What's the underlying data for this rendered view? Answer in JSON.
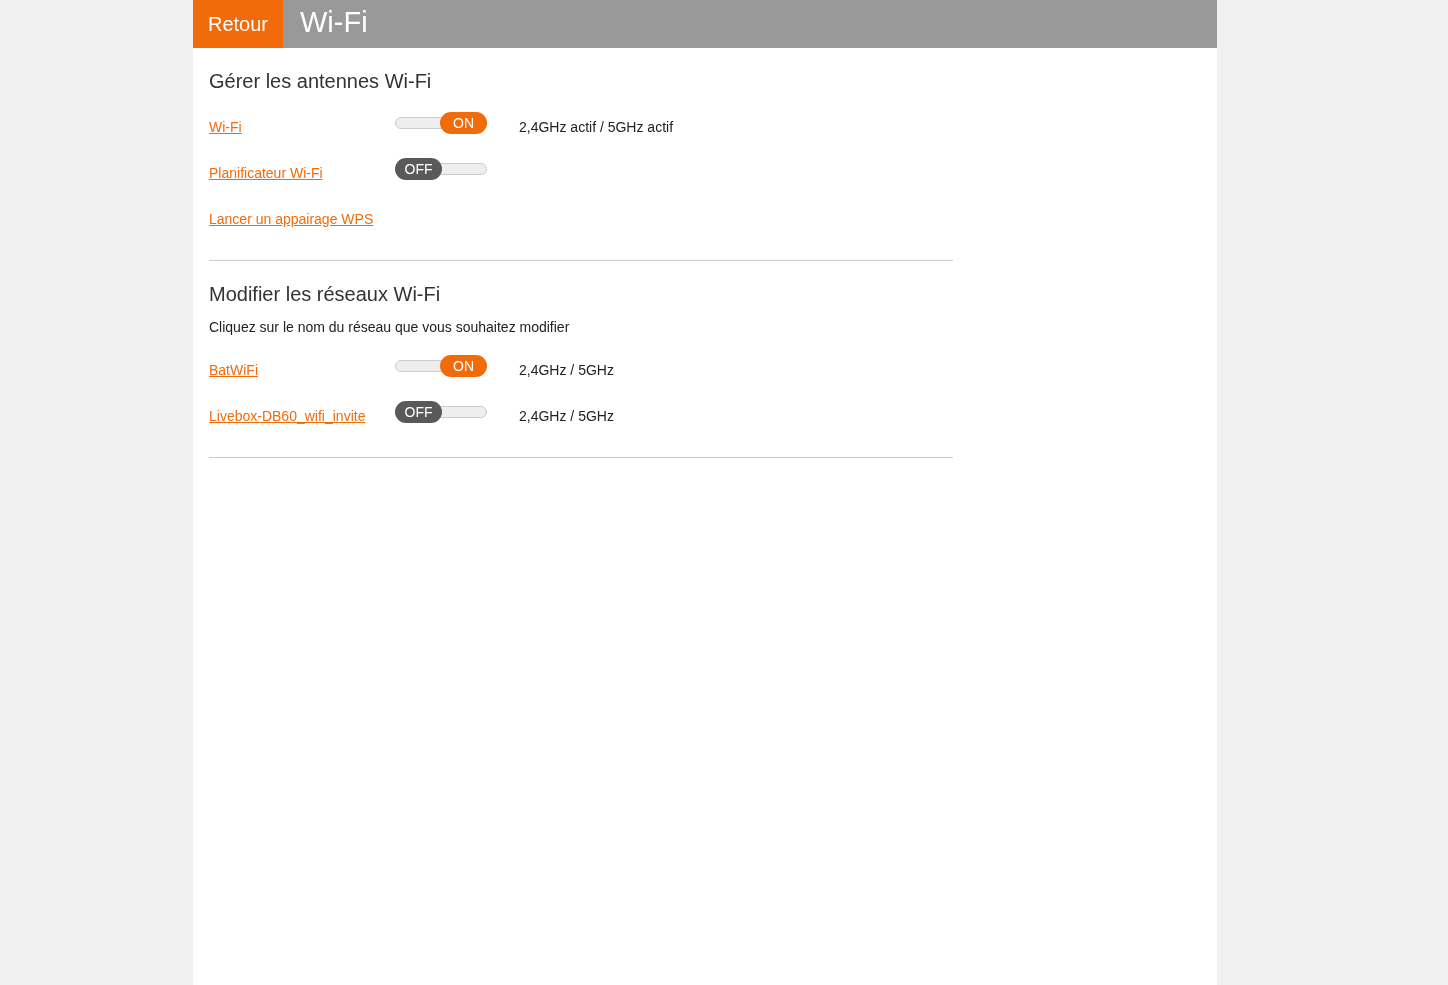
{
  "header": {
    "back_button": "Retour",
    "title": "Wi-Fi"
  },
  "sections": [
    {
      "title": "Gérer les antennes Wi-Fi",
      "rows": [
        {
          "label": "Wi-Fi",
          "toggle": {
            "on": true,
            "label": "ON"
          },
          "status": "2,4GHz actif / 5GHz actif"
        },
        {
          "label": "Planificateur Wi-Fi",
          "toggle": {
            "on": false,
            "label": "OFF"
          }
        },
        {
          "label": "Lancer un appairage WPS"
        }
      ]
    },
    {
      "title": "Modifier les réseaux Wi-Fi",
      "hint": "Cliquez sur le nom du réseau que vous souhaitez modifier",
      "rows": [
        {
          "label": "BatWiFi",
          "toggle": {
            "on": true,
            "label": "ON"
          },
          "status": "2,4GHz / 5GHz"
        },
        {
          "label": "Livebox-DB60_wifi_invite",
          "toggle": {
            "on": false,
            "label": "OFF"
          },
          "status": "2,4GHz / 5GHz"
        }
      ]
    }
  ]
}
